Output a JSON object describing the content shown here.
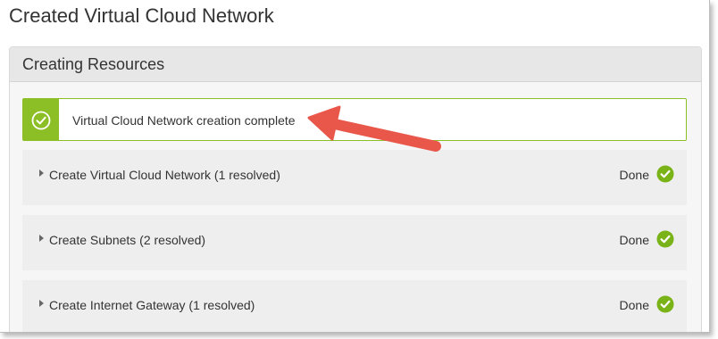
{
  "page": {
    "title": "Created Virtual Cloud Network"
  },
  "panel": {
    "title": "Creating Resources"
  },
  "alert": {
    "icon": "check-circle-icon",
    "text": "Virtual Cloud Network creation complete",
    "color": "#8cbf26"
  },
  "tasks": [
    {
      "label": "Create Virtual Cloud Network (1 resolved)",
      "status": "Done",
      "icon": "check-circle-icon"
    },
    {
      "label": "Create Subnets (2 resolved)",
      "status": "Done",
      "icon": "check-circle-icon"
    },
    {
      "label": "Create Internet Gateway (1 resolved)",
      "status": "Done",
      "icon": "check-circle-icon"
    }
  ],
  "colors": {
    "success": "#7ab317",
    "arrow": "#e8574a"
  }
}
